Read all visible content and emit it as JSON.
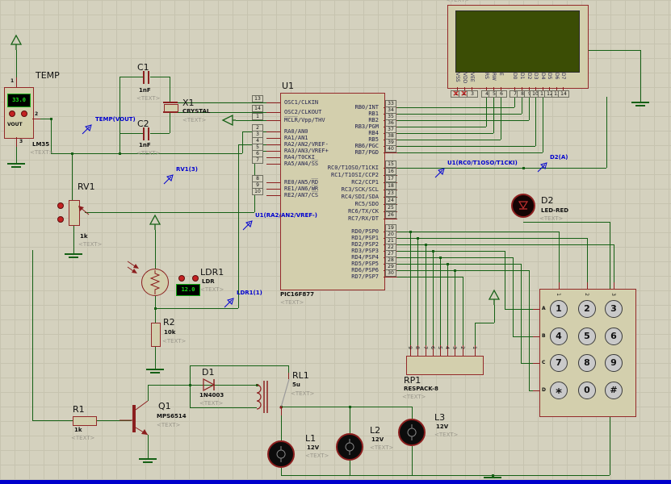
{
  "placeholder": "<TEXT>",
  "colors": {
    "wire": "#156015",
    "component": "#8b1e1e",
    "canvas": "#d4d1be",
    "screen": "#3b4d05",
    "net_label": "#0000d0",
    "status_bar": "#0000cc"
  },
  "u1": {
    "ref": "U1",
    "part": "PIC16F877",
    "left_pins": [
      {
        "n": "13",
        "l": "OSC1/CLKIN"
      },
      {
        "n": "14",
        "l": "OSC2/CLKOUT"
      },
      {
        "n": "1",
        "l": "M̅C̅L̅R̅/Vpp/THV"
      },
      {
        "n": "2",
        "l": "RA0/AN0"
      },
      {
        "n": "3",
        "l": "RA1/AN1"
      },
      {
        "n": "4",
        "l": "RA2/AN2/VREF-"
      },
      {
        "n": "5",
        "l": "RA3/AN3/VREF+"
      },
      {
        "n": "6",
        "l": "RA4/T0CKI"
      },
      {
        "n": "7",
        "l": "RA5/AN4/S̅S̅"
      },
      {
        "n": "8",
        "l": "RE0/AN5/R̅D̅"
      },
      {
        "n": "9",
        "l": "RE1/AN6/W̅R̅"
      },
      {
        "n": "10",
        "l": "RE2/AN7/C̅S̅"
      }
    ],
    "rb": [
      {
        "n": "33",
        "l": "RB0/INT"
      },
      {
        "n": "34",
        "l": "RB1"
      },
      {
        "n": "35",
        "l": "RB2"
      },
      {
        "n": "36",
        "l": "RB3/PGM"
      },
      {
        "n": "37",
        "l": "RB4"
      },
      {
        "n": "38",
        "l": "RB5"
      },
      {
        "n": "39",
        "l": "RB6/PGC"
      },
      {
        "n": "40",
        "l": "RB7/PGD"
      }
    ],
    "rc": [
      {
        "n": "15",
        "l": "RC0/T1OSO/T1CKI"
      },
      {
        "n": "16",
        "l": "RC1/T1OSI/CCP2"
      },
      {
        "n": "17",
        "l": "RC2/CCP1"
      },
      {
        "n": "18",
        "l": "RC3/SCK/SCL"
      },
      {
        "n": "23",
        "l": "RC4/SDI/SDA"
      },
      {
        "n": "24",
        "l": "RC5/SDO"
      },
      {
        "n": "25",
        "l": "RC6/TX/CK"
      },
      {
        "n": "26",
        "l": "RC7/RX/DT"
      }
    ],
    "rd": [
      {
        "n": "19",
        "l": "RD0/PSP0"
      },
      {
        "n": "20",
        "l": "RD1/PSP1"
      },
      {
        "n": "21",
        "l": "RD2/PSP2"
      },
      {
        "n": "22",
        "l": "RD3/PSP3"
      },
      {
        "n": "27",
        "l": "RD4/PSP4"
      },
      {
        "n": "28",
        "l": "RD5/PSP5"
      },
      {
        "n": "29",
        "l": "RD6/PSP6"
      },
      {
        "n": "30",
        "l": "RD7/PSP7"
      }
    ]
  },
  "lcd": {
    "pins": [
      {
        "n": "1",
        "l": "VSS"
      },
      {
        "n": "2",
        "l": "VDD"
      },
      {
        "n": "3",
        "l": "VEE"
      },
      {
        "n": "4",
        "l": "RS"
      },
      {
        "n": "5",
        "l": "RW"
      },
      {
        "n": "6",
        "l": "E"
      },
      {
        "n": "7",
        "l": "D0"
      },
      {
        "n": "8",
        "l": "D1"
      },
      {
        "n": "9",
        "l": "D2"
      },
      {
        "n": "10",
        "l": "D3"
      },
      {
        "n": "11",
        "l": "D4"
      },
      {
        "n": "12",
        "l": "D5"
      },
      {
        "n": "13",
        "l": "D6"
      },
      {
        "n": "14",
        "l": "D7"
      }
    ]
  },
  "temp": {
    "ref": "TEMP",
    "part": "LM35",
    "reading": "33.0",
    "vout": "VOUT",
    "pin1": "1",
    "pin2": "2",
    "pin3": "3"
  },
  "c1": {
    "ref": "C1",
    "value": "1nF"
  },
  "c2": {
    "ref": "C2",
    "value": "1nF"
  },
  "x1": {
    "ref": "X1",
    "part": "CRYSTAL"
  },
  "rv1": {
    "ref": "RV1",
    "value": "1k"
  },
  "ldr": {
    "ref": "LDR1",
    "part": "LDR",
    "reading": "12.0"
  },
  "r2": {
    "ref": "R2",
    "value": "10k"
  },
  "r1": {
    "ref": "R1",
    "value": "1k"
  },
  "q1": {
    "ref": "Q1",
    "part": "MPS6514"
  },
  "d1": {
    "ref": "D1",
    "part": "1N4003"
  },
  "rl1": {
    "ref": "RL1",
    "value": "5u"
  },
  "d2": {
    "ref": "D2",
    "part": "LED-RED"
  },
  "rp1": {
    "ref": "RP1",
    "part": "RESPACK-8",
    "p1": "9",
    "p2": "8",
    "p3": "7",
    "p4": "6",
    "p5": "5",
    "p6": "4",
    "p7": "3",
    "p8": "2",
    "p9": "1"
  },
  "lamps": [
    {
      "ref": "L1",
      "value": "12V"
    },
    {
      "ref": "L2",
      "value": "12V"
    },
    {
      "ref": "L3",
      "value": "12V"
    }
  ],
  "keypad": {
    "rows": [
      "A",
      "B",
      "C",
      "D"
    ],
    "cols": [
      "1",
      "2",
      "3"
    ],
    "keys": [
      "1",
      "2",
      "3",
      "4",
      "5",
      "6",
      "7",
      "8",
      "9",
      "*",
      "0",
      "#"
    ]
  },
  "nets": {
    "temp_vout": "TEMP(VOUT)",
    "rv1_3": "RV1(3)",
    "ra2": "U1(RA2/AN2/VREF-)",
    "ldr1_1": "LDR1(1)",
    "rc0": "U1(RC0/T1OSO/T1CKI)",
    "d2_a": "D2(A)"
  }
}
